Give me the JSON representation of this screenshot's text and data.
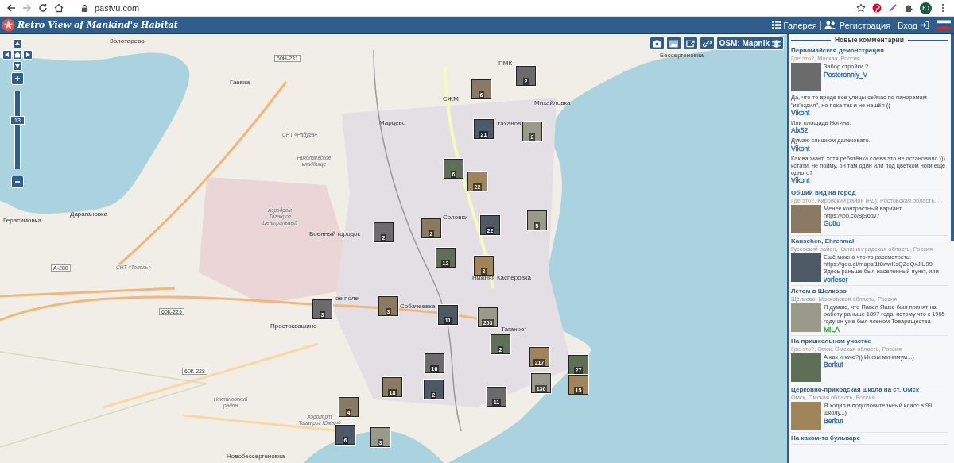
{
  "browser": {
    "url": "pastvu.com",
    "avatar": "Ю"
  },
  "header": {
    "logo_text": "Retro View of Mankind's Habitat",
    "links": [
      {
        "kind": "gallery",
        "label": "Галерея"
      },
      {
        "kind": "register",
        "label": "Регистрация"
      },
      {
        "kind": "login",
        "label": "Вход"
      }
    ]
  },
  "map": {
    "layer": "OSM: Mapnik",
    "zoom": {
      "label": "13",
      "level": 0.62
    },
    "labels": [
      {
        "text": "Золотарево",
        "kind": "place"
      },
      {
        "text": "60Н-231",
        "kind": "road"
      },
      {
        "text": "Гаевка",
        "kind": "place"
      },
      {
        "text": "ПМК",
        "kind": "place"
      },
      {
        "text": "СЖМ",
        "kind": "place"
      },
      {
        "text": "Михайловка",
        "kind": "place"
      },
      {
        "text": "Марцево",
        "kind": "place"
      },
      {
        "text": "Стаханов",
        "kind": "place"
      },
      {
        "text": "СНТ «Радуга»",
        "kind": "small"
      },
      {
        "text": "Николаевское кладбище",
        "kind": "small"
      },
      {
        "text": "Герасимовка",
        "kind": "place"
      },
      {
        "text": "Дарагановка",
        "kind": "place"
      },
      {
        "text": "Аэродром Таганрог Центральный",
        "kind": "small"
      },
      {
        "text": "Соловки",
        "kind": "place"
      },
      {
        "text": "Военный городок",
        "kind": "place"
      },
      {
        "text": "А-280",
        "kind": "road"
      },
      {
        "text": "СНТ «Тополь»",
        "kind": "small"
      },
      {
        "text": "Нижняя Касперовка",
        "kind": "place"
      },
      {
        "text": "60К-229",
        "kind": "road"
      },
      {
        "text": "ое поле",
        "kind": "place"
      },
      {
        "text": "Простоквашино",
        "kind": "place"
      },
      {
        "text": "Собачеевка",
        "kind": "place"
      },
      {
        "text": "Таганрог",
        "kind": "place"
      },
      {
        "text": "60К-228",
        "kind": "road"
      },
      {
        "text": "Неклиновский район",
        "kind": "small"
      },
      {
        "text": "Аэропорт Таганрог Южный",
        "kind": "small"
      },
      {
        "text": "Новобессергеновка",
        "kind": "place"
      },
      {
        "text": "Бессергеновка",
        "kind": "place"
      }
    ],
    "markers": [
      {
        "count": "2"
      },
      {
        "count": "6"
      },
      {
        "count": "21"
      },
      {
        "count": "2"
      },
      {
        "count": "6"
      },
      {
        "count": "22"
      },
      {
        "count": "2"
      },
      {
        "count": "2"
      },
      {
        "count": "22"
      },
      {
        "count": "5"
      },
      {
        "count": "12"
      },
      {
        "count": "3"
      },
      {
        "count": "3"
      },
      {
        "count": "3"
      },
      {
        "count": "11"
      },
      {
        "count": "253"
      },
      {
        "count": "2"
      },
      {
        "count": "217"
      },
      {
        "count": "16"
      },
      {
        "count": "18"
      },
      {
        "count": "2"
      },
      {
        "count": "136"
      },
      {
        "count": "27"
      },
      {
        "count": "15"
      },
      {
        "count": "11"
      },
      {
        "count": "4"
      },
      {
        "count": "6"
      },
      {
        "count": "3"
      }
    ]
  },
  "sidebar": {
    "title": "Новые комментарии",
    "groups": [
      {
        "title": "Первомайская демонстрация",
        "where": "Где это?",
        "location": ", Москва, Россия",
        "comments": [
          {
            "text": "Забор стройки ?",
            "author": "Postoronniy_V",
            "color": "#2e6da4"
          },
          {
            "text": "Да, что-то вроде все улицы сейчас по панорамам \"из'ездил\", но пока так и не нашёл ((",
            "author": "Vikont",
            "color": "#2e6da4"
          },
          {
            "text": "Или площадь Ногина.",
            "author": "Alx52",
            "color": "#2e6da4"
          },
          {
            "text": "Думаю слишком далековато..",
            "author": "Vikont",
            "color": "#2e6da4"
          },
          {
            "text": "Как вариант, хотя ребятёнка слева это не остановило ))) кстати, не пойму, он там один или под цветком ноги ещё одного?",
            "author": "Vikont",
            "color": "#2e6da4"
          }
        ]
      },
      {
        "title": "Общий вид на город",
        "where": "Где это?",
        "location": ", Кировский район (РД), Ростовская область, ...",
        "comments": [
          {
            "text": "Менее контрастный вариант https://ibb.co/8jS6dv7",
            "author": "Gotto",
            "color": "#2e6da4"
          }
        ]
      },
      {
        "title": "Kauschen, Ehrenmal",
        "location": "Гусевский район, Калининградская область, Россия",
        "comments": [
          {
            "text": "Ещё можно что-то рассмотреть: https://goo.gl/maps/1t8wwKsQZoQxJiU99 Здесь раньше был населенный пункт, или",
            "author": "vorleser",
            "color": "#2e6da4"
          }
        ]
      },
      {
        "title": "Летом в Щелково",
        "location": "Щёлково, Московская область, Россия",
        "comments": [
          {
            "text": "Я думаю, что Павел Яшке был принят на работу раньше 1897 года, потому что к 1905 году он уже был членом Товарищества",
            "author": "MILA",
            "color": "#2ea02e"
          }
        ]
      },
      {
        "title": "На пришкольном участке",
        "where": "Где это?",
        "location": ", Омск, Омская область, Россия",
        "comments": [
          {
            "text": "А как иначе?)) Инфы минимум...)",
            "author": "Berkut",
            "color": "#2e6da4"
          }
        ]
      },
      {
        "title": "Церковно-приходская школа на ст. Омск",
        "location": "Омск, Омская область, Россия",
        "comments": [
          {
            "text": "Я ходил в подготовительный класс в 99 школу...)",
            "author": "Berkut",
            "color": "#2e6da4"
          }
        ]
      },
      {
        "title": "На каком-то бульваре"
      }
    ]
  }
}
